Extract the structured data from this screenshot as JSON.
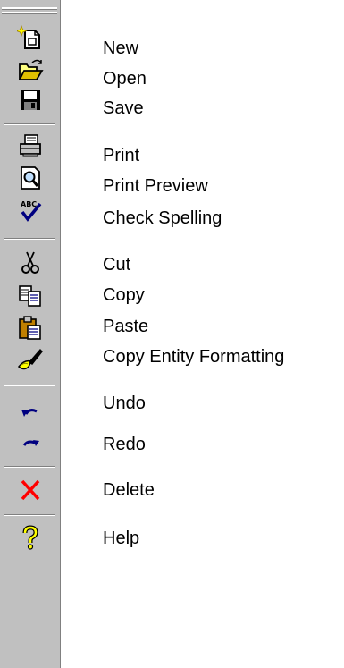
{
  "toolbar": {
    "orientation": "vertical",
    "background": "#c0c0c0",
    "items": [
      {
        "id": "new",
        "label": "New",
        "icon": "new-document-icon"
      },
      {
        "id": "open",
        "label": "Open",
        "icon": "open-folder-icon"
      },
      {
        "id": "save",
        "label": "Save",
        "icon": "floppy-disk-icon"
      },
      {
        "id": "print",
        "label": "Print",
        "icon": "printer-icon"
      },
      {
        "id": "print-preview",
        "label": "Print Preview",
        "icon": "magnifier-page-icon"
      },
      {
        "id": "check-spelling",
        "label": "Check Spelling",
        "icon": "abc-check-icon"
      },
      {
        "id": "cut",
        "label": "Cut",
        "icon": "scissors-icon"
      },
      {
        "id": "copy",
        "label": "Copy",
        "icon": "copy-pages-icon"
      },
      {
        "id": "paste",
        "label": "Paste",
        "icon": "clipboard-icon"
      },
      {
        "id": "copy-entity-formatting",
        "label": "Copy Entity Formatting",
        "icon": "paintbrush-icon"
      },
      {
        "id": "undo",
        "label": "Undo",
        "icon": "undo-arrow-icon"
      },
      {
        "id": "redo",
        "label": "Redo",
        "icon": "redo-arrow-icon"
      },
      {
        "id": "delete",
        "label": "Delete",
        "icon": "red-x-icon"
      },
      {
        "id": "help",
        "label": "Help",
        "icon": "question-mark-icon"
      }
    ]
  }
}
